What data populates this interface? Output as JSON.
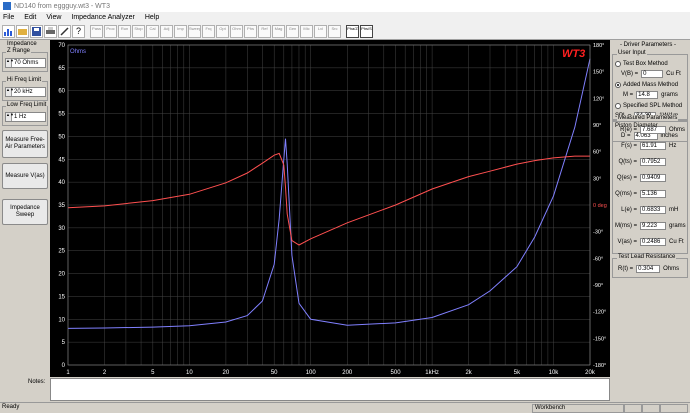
{
  "window": {
    "title": "ND140 from eggguy.wt3 - WT3",
    "icon": "app-icon"
  },
  "menu": [
    "File",
    "Edit",
    "View",
    "Impedance Analyzer",
    "Help"
  ],
  "toolbar": {
    "buttons": [
      "Pass",
      "Proc",
      "Run",
      "Stop",
      "Cal",
      "Adj",
      "Imp",
      "Sweep",
      "Frq",
      "Opt",
      "Ohm",
      "Phs",
      "Ref",
      "Mag",
      "Gen",
      "Mic",
      "Lvl",
      "Src"
    ],
    "view_buttons": [
      "Pha/Z",
      "Phs/S"
    ]
  },
  "left": {
    "impedance_label": "Impedance",
    "z_range_label": "Z Range",
    "z_range_value": "70 Ohms",
    "hi_freq_label": "Hi Freq Limit",
    "hi_freq_value": "20 kHz",
    "low_freq_label": "Low Freq Limit",
    "low_freq_value": "1 Hz",
    "btn_free_air": "Measure Free-Air Parameters",
    "btn_vas": "Measure V(as)",
    "btn_sweep": "Impedance Sweep"
  },
  "right": {
    "title": "Driver Parameters",
    "user_input": "User Input",
    "test_box": "Test Box Method",
    "vb_label": "V(B) =",
    "vb_value": "0",
    "vb_unit": "Cu Ft",
    "added_mass": "Added Mass Method",
    "m_label": "M =",
    "m_value": "14.8",
    "m_unit": "grams",
    "spl_method": "Specified SPL Method",
    "spl_label": "SPL =",
    "spl_value": "84.39",
    "spl_unit": "1W/1m",
    "piston": "Piston Diameter",
    "d_label": "D =",
    "d_value": "4.063",
    "d_unit": "inches",
    "measured": "Measured Parameters",
    "params": [
      {
        "label": "R(e) =",
        "value": "7.687",
        "unit": "Ohms"
      },
      {
        "label": "F(s) =",
        "value": "61.91",
        "unit": "Hz"
      },
      {
        "label": "Q(ts) =",
        "value": "0.7952",
        "unit": ""
      },
      {
        "label": "Q(es) =",
        "value": "0.9409",
        "unit": ""
      },
      {
        "label": "Q(ms) =",
        "value": "5.136",
        "unit": ""
      },
      {
        "label": "L(e) =",
        "value": "0.6833",
        "unit": "mH"
      },
      {
        "label": "M(ms) =",
        "value": "9.223",
        "unit": "grams"
      },
      {
        "label": "V(as) =",
        "value": "0.2486",
        "unit": "Cu Ft"
      }
    ],
    "test_lead": "Test Lead Resistance",
    "rt_label": "R(t) =",
    "rt_value": "0.304",
    "rt_unit": "Ohms"
  },
  "notes_label": "Notes:",
  "status": {
    "left": "Ready",
    "mode": "Workbench"
  },
  "chart_data": {
    "type": "line",
    "title": "",
    "logo": "WT3",
    "x_ticks": [
      "1",
      "2",
      "5",
      "10",
      "20",
      "50",
      "100",
      "200",
      "500",
      "1kHz",
      "2k",
      "5k",
      "10k",
      "20k"
    ],
    "x_tick_values": [
      1,
      2,
      5,
      10,
      20,
      50,
      100,
      200,
      500,
      1000,
      2000,
      5000,
      10000,
      20000
    ],
    "xlim": [
      1,
      20000
    ],
    "x_scale": "log",
    "y_left_label": "Ohms",
    "y_left_ticks": [
      0,
      5,
      10,
      15,
      20,
      25,
      30,
      35,
      40,
      45,
      50,
      55,
      60,
      65,
      70
    ],
    "ylim_left": [
      0,
      70
    ],
    "y_right_ticks": [
      "180°",
      "150°",
      "120°",
      "90°",
      "60°",
      "30°",
      "0 deg",
      "-30°",
      "-60°",
      "-90°",
      "-120°",
      "-150°",
      "-180°"
    ],
    "ylim_right": [
      -180,
      180
    ],
    "grid": true,
    "colors": {
      "impedance": "#8080ff",
      "phase": "#ff5050",
      "axis_text": "#ffffff",
      "grid": "#444444"
    },
    "series": [
      {
        "key": "impedance",
        "x": [
          1,
          2,
          5,
          10,
          20,
          30,
          40,
          50,
          55,
          60,
          62,
          64,
          70,
          80,
          100,
          200,
          500,
          1000,
          2000,
          3000,
          5000,
          7000,
          10000,
          15000,
          20000
        ],
        "y": [
          8.0,
          8.1,
          8.3,
          8.6,
          9.4,
          10.8,
          14.0,
          22.0,
          32.0,
          45.0,
          49.5,
          44.0,
          24.0,
          13.5,
          10.0,
          8.7,
          9.2,
          10.4,
          13.2,
          16.2,
          21.5,
          28.0,
          37.0,
          52.0,
          67.0
        ]
      },
      {
        "key": "phase",
        "x": [
          1,
          2,
          5,
          10,
          20,
          30,
          40,
          50,
          55,
          60,
          62,
          64,
          70,
          80,
          100,
          200,
          500,
          1000,
          2000,
          3000,
          5000,
          7000,
          10000,
          15000,
          20000
        ],
        "y": [
          -3,
          -1,
          5,
          12,
          25,
          36,
          47,
          56,
          58,
          45,
          20,
          -10,
          -40,
          -45,
          -38,
          -20,
          0,
          18,
          32,
          38,
          46,
          50,
          53,
          55,
          55
        ]
      }
    ]
  }
}
